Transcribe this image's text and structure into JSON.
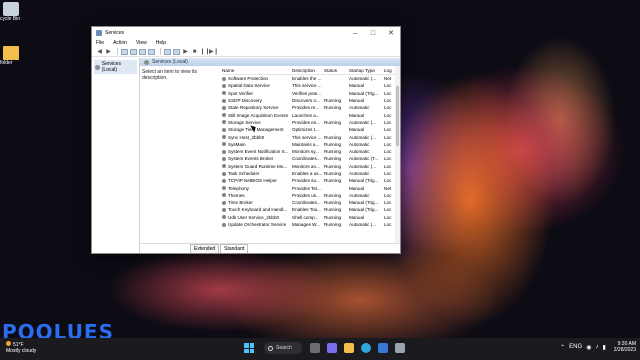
{
  "desktop": {
    "icons": [
      {
        "label": "cycle Bin"
      },
      {
        "label": "folder"
      }
    ],
    "watermark": "POOLUES"
  },
  "window": {
    "title": "Services",
    "menu": [
      "File",
      "Action",
      "View",
      "Help"
    ],
    "tree_item": "Services (Local)",
    "header": "Services (Local)",
    "description_prompt": "Select an item to view its description.",
    "columns": [
      "Name",
      "Description",
      "Status",
      "Startup Type",
      "Log"
    ],
    "rows": [
      [
        "Software Protection",
        "Enables the ...",
        "",
        "Automatic (...",
        "Net"
      ],
      [
        "Spatial Data Service",
        "This service ...",
        "",
        "Manual",
        "Loc"
      ],
      [
        "Spot Verifier",
        "Verifies pote...",
        "",
        "Manual (Trig...",
        "Loc"
      ],
      [
        "SSDP Discovery",
        "Discovers n...",
        "Running",
        "Manual",
        "Loc"
      ],
      [
        "State Repository Service",
        "Provides re...",
        "Running",
        "Automatic",
        "Loc"
      ],
      [
        "Still Image Acquisition Events",
        "Launches a...",
        "",
        "Manual",
        "Loc"
      ],
      [
        "Storage Service",
        "Provides en...",
        "Running",
        "Automatic (...",
        "Loc"
      ],
      [
        "Storage Tiers Management",
        "Optimizes t...",
        "",
        "Manual",
        "Loc"
      ],
      [
        "Sync Host_2bbb0",
        "This service ...",
        "Running",
        "Automatic (...",
        "Loc"
      ],
      [
        "SysMain",
        "Maintains a...",
        "Running",
        "Automatic",
        "Loc"
      ],
      [
        "System Event Notification S...",
        "Monitors sy...",
        "Running",
        "Automatic",
        "Loc"
      ],
      [
        "System Events Broker",
        "Coordinates...",
        "Running",
        "Automatic (T...",
        "Loc"
      ],
      [
        "System Guard Runtime Mo...",
        "Monitors an...",
        "Running",
        "Automatic (...",
        "Loc"
      ],
      [
        "Task Scheduler",
        "Enables a us...",
        "Running",
        "Automatic",
        "Loc"
      ],
      [
        "TCP/IP NetBIOS Helper",
        "Provides su...",
        "Running",
        "Manual (Trig...",
        "Loc"
      ],
      [
        "Telephony",
        "Provides Tel...",
        "",
        "Manual",
        "Net"
      ],
      [
        "Themes",
        "Provides us...",
        "Running",
        "Automatic",
        "Loc"
      ],
      [
        "Time Broker",
        "Coordinates...",
        "Running",
        "Manual (Trig...",
        "Loc"
      ],
      [
        "Touch Keyboard and Handl...",
        "Enables Tou...",
        "Running",
        "Manual (Trig...",
        "Loc"
      ],
      [
        "Udk User Service_2bbb0",
        "Shell comp...",
        "Running",
        "Manual",
        "Loc"
      ],
      [
        "Update Orchestrator Service",
        "Manages W...",
        "Running",
        "Automatic (...",
        "Loc"
      ]
    ],
    "tabs": [
      "Extended",
      "Standard"
    ]
  },
  "taskbar": {
    "weather_temp": "51°F",
    "weather_text": "Mostly cloudy",
    "search_label": "Search",
    "lang": "ENG",
    "time": "9:30 AM",
    "date": "2/28/2023"
  },
  "colors": {
    "accent": "#4cc2ff",
    "watermark": "#2a6df0"
  }
}
